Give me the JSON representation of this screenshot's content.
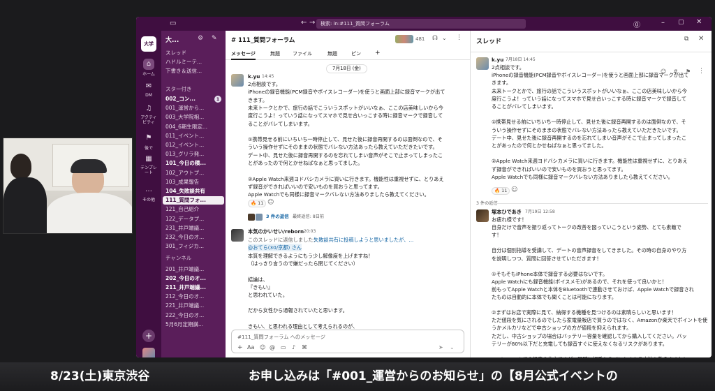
{
  "titlebar": {
    "search": "検索: in:#111_質問フォーラム"
  },
  "workspace": {
    "badge": "大学",
    "rail": [
      {
        "label": "ホーム",
        "icon": "home-icon"
      },
      {
        "label": "DM",
        "icon": "dm-icon"
      },
      {
        "label": "アクティビティ",
        "icon": "bell-icon"
      },
      {
        "label": "後で",
        "icon": "bookmark-icon"
      },
      {
        "label": "テンプレート",
        "icon": "template-icon"
      },
      {
        "label": "その他",
        "icon": "more-icon"
      }
    ]
  },
  "sidebar": {
    "name": "大...",
    "top": [
      "スレッド",
      "ハドルミーテ...",
      "下書き＆送信..."
    ],
    "starred_header": "スター付き",
    "starred": [
      "002_コン...",
      "001_運営から...",
      "003_大学院相...",
      "004_6期生限定...",
      "011_イベント...",
      "012_イベント...",
      "013_グリラ発...",
      "101_今日の積...",
      "102_アウトプ...",
      "103_成果報告",
      "104_失敗談共有",
      "111_質問フォ...",
      "121_自己紹介",
      "122_データプ...",
      "231_井戸端議...",
      "232_今日のオ...",
      "301_フィジカ..."
    ],
    "starred_badge": "1",
    "channel_header": "チャンネル",
    "channels": [
      "201_井戸端議...",
      "202_今日のオ...",
      "211_井戸端議...",
      "212_今日のオ...",
      "221_井戸端議...",
      "222_今日のオ...",
      "5月6月定期講..."
    ]
  },
  "main": {
    "channel": "# 111_質問フォーラム",
    "member_count": "481",
    "tabs": [
      "メッセージ",
      "無題",
      "ファイル",
      "無題",
      "ピン"
    ],
    "date_pill": "7月18日 (金)",
    "msg1": {
      "author": "k.yu",
      "time": "14:45",
      "lines": [
        "2点相談です。",
        "iPhoneの録音機能(PCM録音やボイスレコーダー)を使うと画面上部に録音マークが出て",
        "きます。",
        "未来トークとかで、旅行の話でこういうスポットがいいなぁ、ここの店美味しいから今",
        "度行こうよ！っていう話になってスマホで見せ合いっこする時に録音マークで録音して",
        "ることがバレてしまいます。",
        "",
        "①携帯見せる前にいちいち一時停止して、見せた後に録音再開するのは面倒なので、そ",
        "ういう操作せずにそのままの状態でバレない方法あったら教えていただきたいです。",
        "デート中、見せた後に録音再開するのを忘れてしまい音声がそこで止まってしまったこ",
        "とがあったので何とかせねばなぁと思ってました。",
        "",
        "②Apple Watch来週ヨドバシカメラに買いに行きます。機能性は重視せずに、とりあえ",
        "ず録音ができればいいので安いものを買おうと思ってます。",
        "Apple Watchでも同様に録音マークバレない方法ありましたら教えてください。"
      ],
      "reaction": "🔥 11",
      "replies": "3 件の返信",
      "replies_time": "最終返信: 8日前"
    },
    "msg2": {
      "author": "本気のかいせい/reborn",
      "time": "20:03",
      "quote": "このスレッドに返信しました：",
      "quote_link": "失敗談共有に投稿しようと思いましたが、...",
      "mention": "@おてら(30/京都) さん",
      "lines": [
        "本質を理解できるようにもう少し解像度を上げますね！",
        "（はっきり言うので嫌だったら閉じてください）",
        "",
        "結論は、",
        "『きもい』",
        "と思われていた。",
        "",
        "だから女性から通報されていたと思います。",
        "",
        "きもい、と思われる理由として考えられるのが、"
      ]
    },
    "composer": "#111_質問フォーラム へのメッセージ"
  },
  "thread": {
    "title": "スレッド",
    "msg": {
      "author": "k.yu",
      "time": "7月18日 14:45",
      "lines": [
        "2点相談です。",
        "iPhoneの録音機能(PCM録音やボイスレコーダー)を使うと画面上部に録音マークが出て",
        "きます。",
        "未来トークとかで、旅行の話でこういうスポットがいいなぁ、ここの店美味しいから今",
        "度行こうよ！っていう話になってスマホで見せ合いっこする時に録音マークで録音して",
        "ることがバレてしまいます。",
        "",
        "①携帯見せる前にいちいち一時停止して、見せた後に録音再開するのは面倒なので、そ",
        "ういう操作せずにそのままの状態でバレない方法あったら教えていただきたいです。",
        "デート中、見せた後に録音再開するのを忘れてしまい音声がそこで止まってしまったこ",
        "とがあったので何とかせねばなぁと思ってました。",
        "",
        "②Apple Watch来週ヨドバシカメラに買いに行きます。機能性は重視せずに、とりあえ",
        "ず録音ができればいいので安いものを買おうと思ってます。",
        "Apple Watchでも同様に録音マークバレない方法ありましたら教えてください。"
      ],
      "reaction": "🔥 11"
    },
    "reply_count": "3 件の返信",
    "reply": {
      "author": "塚本ひであき",
      "time": "7月19日 12:58",
      "lines": [
        "お疲れ様です！",
        "自身だけで音声を振り返ってトークの改善を図っていこうという姿勢、とても素敵で",
        "す！",
        "",
        "自分は個別指導を受講して、デートの音声録音をしてきました。その時の自身のやり方",
        "を説明しつつ、質問に回答させていただきます！",
        "",
        "①そもそもiPhone本体で録音する必要はないです。",
        "Apple Watchにも録音機能(ボイスメモ)があるので、それを使って良いかと！",
        "前もってApple Watchと本体をBluetoothで連動させておけば、Apple Watchで録音され",
        "たものは自動的に本体でも聞くことは可能になります。",
        "",
        "②まずはお店で実際に見て、納得する機種を見つけるのは素晴らしいと思います！",
        "ただ値段を気にされるのでしたら家電量販店で買うのではなく、Amazonか楽天でポイントを使",
        "うかメルカリなどで中古ショップの方が値段を抑えられます。",
        "ただし、中古ショップの場合はバッテリー容量を確認してから購入してください。バッ",
        "テリーが80%以下だと充電しても録音すぐに使えなくなるリスクがあります。",
        "",
        "Apple watchでの録音の仕方ですが、同時に相手からバレなくなる方法も教えますね！",
        "5つの写真を挙げてるので、写真を見つつ説明文も読んでください。",
        "1. 立ち上げの画面でいつでも録音できるようにしておく。録音の時にアイコンをタッ",
        "   プする。"
      ]
    }
  },
  "ticker": {
    "left": "8/23(土)東京渋谷",
    "right": "お申し込みは「#001_運営からのお知らせ」の【8月公式イベントの"
  }
}
